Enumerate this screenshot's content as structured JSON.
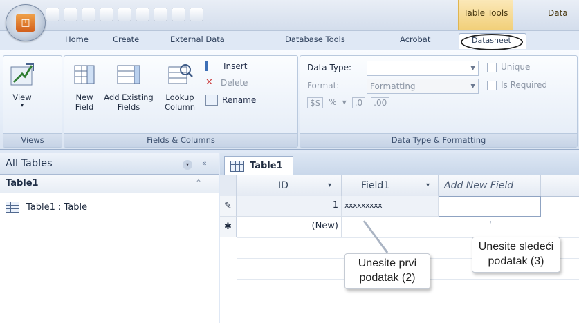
{
  "titlebar": {
    "contextual_group": "Table Tools",
    "next_label_partial": "Data"
  },
  "ribbon_tabs": [
    "Home",
    "Create",
    "External Data",
    "Database Tools",
    "Acrobat",
    "Datasheet"
  ],
  "views_group": {
    "view_label": "View",
    "group_label": "Views"
  },
  "fields_columns_group": {
    "new_field_line1": "New",
    "new_field_line2": "Field",
    "add_existing_line1": "Add Existing",
    "add_existing_line2": "Fields",
    "lookup_line1": "Lookup",
    "lookup_line2": "Column",
    "insert": "Insert",
    "delete": "Delete",
    "rename": "Rename",
    "group_label": "Fields & Columns"
  },
  "datatype_group": {
    "data_type_label": "Data Type:",
    "data_type_value": "",
    "format_label": "Format:",
    "format_value": "Formatting",
    "unique": "Unique",
    "is_required": "Is Required",
    "percent": "%",
    "group_label": "Data Type & Formatting"
  },
  "nav": {
    "title": "All Tables",
    "collapse": "«",
    "group_title": "Table1",
    "item": "Table1 : Table"
  },
  "doc_tab": "Table1",
  "grid": {
    "columns": [
      "ID",
      "Field1",
      "Add New Field"
    ],
    "row1": {
      "id": "1",
      "field1": "xxxxxxxxx",
      "new": ""
    },
    "row2": {
      "id": "(New)"
    }
  },
  "callouts": {
    "second": "Unesite prvi podatak (2)",
    "third": "Unesite sledeći podatak (3)"
  }
}
